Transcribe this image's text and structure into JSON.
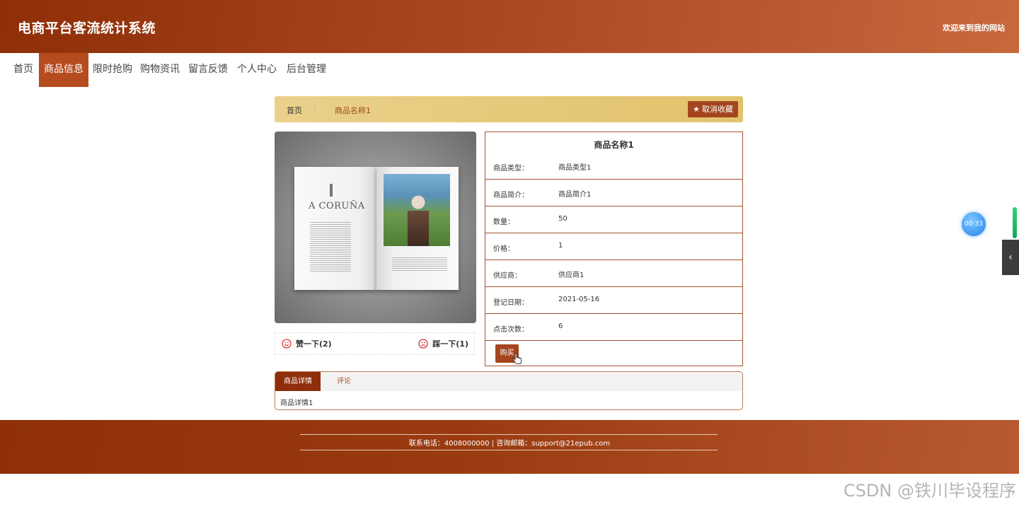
{
  "header": {
    "site_title": "电商平台客流统计系统",
    "welcome": "欢迎来到我的网站"
  },
  "nav": {
    "items": [
      {
        "label": "首页"
      },
      {
        "label": "商品信息",
        "active": true
      },
      {
        "label": "限时抢购"
      },
      {
        "label": "购物资讯"
      },
      {
        "label": "留言反馈"
      },
      {
        "label": "个人中心"
      },
      {
        "label": "后台管理"
      }
    ]
  },
  "breadcrumb": {
    "home": "首页",
    "separator": "/",
    "current": "商品名称1",
    "favorite_button": "取消收藏",
    "favorite_icon": "star-icon"
  },
  "product_image": {
    "book_title": "A CORUÑA"
  },
  "votes": {
    "like_label": "赞一下(2)",
    "dislike_label": "踩一下(1)"
  },
  "product": {
    "name": "商品名称1",
    "rows": [
      {
        "label": "商品类型：",
        "value": "商品类型1"
      },
      {
        "label": "商品简介：",
        "value": "商品简介1"
      },
      {
        "label": "数量：",
        "value": "50"
      },
      {
        "label": "价格：",
        "value": "1"
      },
      {
        "label": "供应商：",
        "value": "供应商1"
      },
      {
        "label": "登记日期：",
        "value": "2021-05-16"
      },
      {
        "label": "点击次数：",
        "value": "6"
      }
    ],
    "buy_button": "购买"
  },
  "tabs": {
    "items": [
      {
        "label": "商品详情",
        "active": true
      },
      {
        "label": "评论"
      }
    ],
    "content": "商品详情1"
  },
  "footer": {
    "contact": "联系电话：4008000000 | 咨询邮箱：support@21epub.com"
  },
  "widgets": {
    "timer": "00:33",
    "side_tab_icon": "chevron-left-icon"
  },
  "watermark": "CSDN @铁川毕设程序",
  "colors": {
    "brand": "#a5451e",
    "brand_dark": "#8e2f08",
    "breadcrumb_bg": "#e6c878",
    "border": "#a5512c"
  }
}
